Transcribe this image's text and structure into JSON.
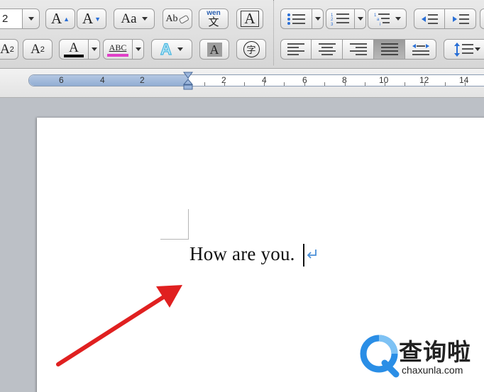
{
  "toolbar": {
    "font_size_value": "2",
    "grow_font_label": "A",
    "shrink_font_label": "A",
    "change_case_label": "Aa",
    "clear_format_label": "Ab",
    "phonetic_top": "wen",
    "phonetic_bottom": "文",
    "char_border_label": "A",
    "superscript_label": "A",
    "superscript_mark": "2",
    "subscript_label": "A",
    "subscript_mark": "2",
    "font_color_label": "A",
    "highlight_label": "ABC",
    "text_effects_label": "A",
    "char_shading_label": "A",
    "enclose_char_label": "字",
    "font_color_hex": "#000000",
    "highlight_color_hex": "#e040c8",
    "text_effects_color_hex": "#47b6e0"
  },
  "ruler": {
    "labels": [
      "6",
      "4",
      "2",
      "2",
      "4",
      "6",
      "8",
      "10",
      "12",
      "14"
    ]
  },
  "document": {
    "text": "How are you."
  },
  "watermark": {
    "name": "查询啦",
    "url": "chaxunla.com",
    "accent_hex": "#2a8ee6"
  },
  "annotation": {
    "arrow_color_hex": "#e02020"
  }
}
